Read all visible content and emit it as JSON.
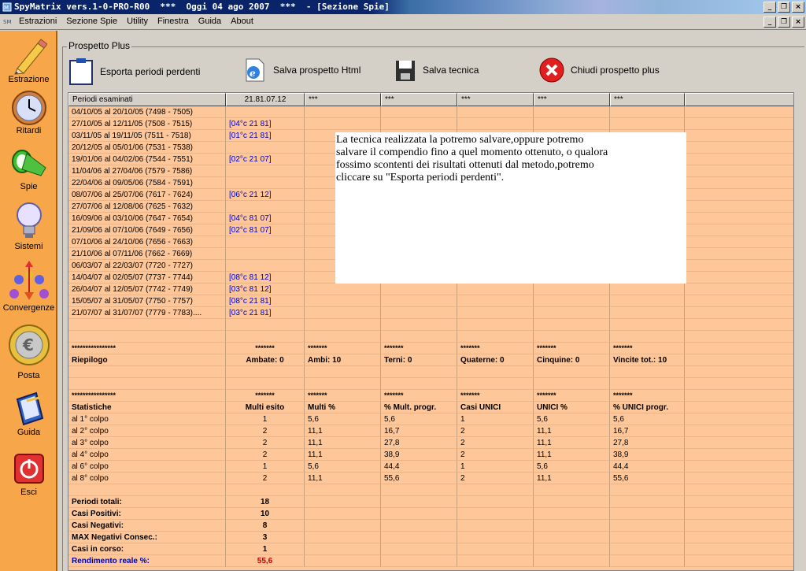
{
  "window": {
    "title": "SpyMatrix vers.1-0-PRO-R00  ***  Oggi 04 ago 2007  ***  - [Sezione Spie]",
    "minimize": "_",
    "restore": "❐",
    "close": "×"
  },
  "menu": {
    "items": [
      "Estrazioni",
      "Sezione Spie",
      "Utility",
      "Finestra",
      "Guida",
      "About"
    ]
  },
  "sidebar": {
    "items": [
      {
        "label": "Estrazione",
        "icon": "pencil-icon"
      },
      {
        "label": "Ritardi",
        "icon": "clock-icon"
      },
      {
        "label": "Spie",
        "icon": "flashlight-icon"
      },
      {
        "label": "Sistemi",
        "icon": "lightbulb-icon"
      },
      {
        "label": "Convergenze",
        "icon": "convergence-icon"
      },
      {
        "label": "Posta",
        "icon": "euro-coin-icon"
      },
      {
        "label": "Guida",
        "icon": "book-icon"
      },
      {
        "label": "Esci",
        "icon": "power-icon"
      }
    ]
  },
  "panel": {
    "title": "Prospetto Plus",
    "actions": {
      "export": "Esporta periodi perdenti",
      "save_html": "Salva prospetto Html",
      "save_tech": "Salva tecnica",
      "close": "Chiudi prospetto plus"
    }
  },
  "grid": {
    "headers": [
      "Periodi esaminati",
      "21.81.07.12",
      "***",
      "***",
      "***",
      "***",
      "***"
    ],
    "periods": [
      {
        "period": "04/10/05 al 20/10/05  (7498 - 7505)",
        "hit": ""
      },
      {
        "period": "27/10/05 al 12/11/05  (7508 - 7515)",
        "hit": "[04°c 21 81]"
      },
      {
        "period": "03/11/05 al 19/11/05  (7511 - 7518)",
        "hit": "[01°c 21 81]"
      },
      {
        "period": "20/12/05 al 05/01/06  (7531 - 7538)",
        "hit": ""
      },
      {
        "period": "19/01/06 al 04/02/06  (7544 - 7551)",
        "hit": "[02°c 21 07]"
      },
      {
        "period": "11/04/06 al 27/04/06  (7579 - 7586)",
        "hit": ""
      },
      {
        "period": "22/04/06 al 09/05/06  (7584 - 7591)",
        "hit": ""
      },
      {
        "period": "08/07/06 al 25/07/06  (7617 - 7624)",
        "hit": "[06°c 21 12]"
      },
      {
        "period": "27/07/06 al 12/08/06  (7625 - 7632)",
        "hit": ""
      },
      {
        "period": "16/09/06 al 03/10/06  (7647 - 7654)",
        "hit": "[04°c 81 07]"
      },
      {
        "period": "21/09/06 al 07/10/06  (7649 - 7656)",
        "hit": "[02°c 81 07]"
      },
      {
        "period": "07/10/06 al 24/10/06  (7656 - 7663)",
        "hit": ""
      },
      {
        "period": "21/10/06 al 07/11/06  (7662 - 7669)",
        "hit": ""
      },
      {
        "period": "06/03/07 al 22/03/07  (7720 - 7727)",
        "hit": ""
      },
      {
        "period": "14/04/07 al 02/05/07  (7737 - 7744)",
        "hit": "[08°c 81 12]"
      },
      {
        "period": "26/04/07 al 12/05/07  (7742 - 7749)",
        "hit": "[03°c 81 12]"
      },
      {
        "period": "15/05/07 al 31/05/07  (7750 - 7757)",
        "hit": "[08°c 21 81]"
      },
      {
        "period": "21/07/07 al 31/07/07  (7779 - 7783)....",
        "hit": "[03°c 21 81]"
      }
    ],
    "stars_label": "****************",
    "stars_cell": "*******",
    "riepilogo": [
      "Riepilogo",
      "Ambate: 0",
      "Ambi: 10",
      "Terni: 0",
      "Quaterne: 0",
      "Cinquine: 0",
      "Vincite tot.: 10"
    ],
    "stat_headers": [
      "Statistiche",
      "Multi esito",
      "Multi %",
      "% Mult. progr.",
      "Casi UNICI",
      "UNICI %",
      "% UNICI progr."
    ],
    "stats": [
      [
        "al 1° colpo",
        "1",
        "5,6",
        "5,6",
        "1",
        "5,6",
        "5,6"
      ],
      [
        "al 2° colpo",
        "2",
        "11,1",
        "16,7",
        "2",
        "11,1",
        "16,7"
      ],
      [
        "al 3° colpo",
        "2",
        "11,1",
        "27,8",
        "2",
        "11,1",
        "27,8"
      ],
      [
        "al 4° colpo",
        "2",
        "11,1",
        "38,9",
        "2",
        "11,1",
        "38,9"
      ],
      [
        "al 6° colpo",
        "1",
        "5,6",
        "44,4",
        "1",
        "5,6",
        "44,4"
      ],
      [
        "al 8° colpo",
        "2",
        "11,1",
        "55,6",
        "2",
        "11,1",
        "55,6"
      ]
    ],
    "summary": [
      {
        "label": "Periodi totali:",
        "value": "18"
      },
      {
        "label": "Casi Positivi:",
        "value": "10"
      },
      {
        "label": "Casi Negativi:",
        "value": "8"
      },
      {
        "label": "MAX Negativi Consec.:",
        "value": "3"
      },
      {
        "label": "Casi in corso:",
        "value": "1"
      },
      {
        "label": "Rendimento reale %:",
        "value": "55,6"
      }
    ]
  },
  "note": {
    "lines": [
      "La tecnica realizzata la potremo salvare,oppure potremo",
      "salvare il compendio fino a quel momento ottenuto, o qualora",
      "fossimo scontenti dei risultati ottenuti dal metodo,potremo",
      "cliccare su \"Esporta periodi perdenti\"."
    ]
  }
}
